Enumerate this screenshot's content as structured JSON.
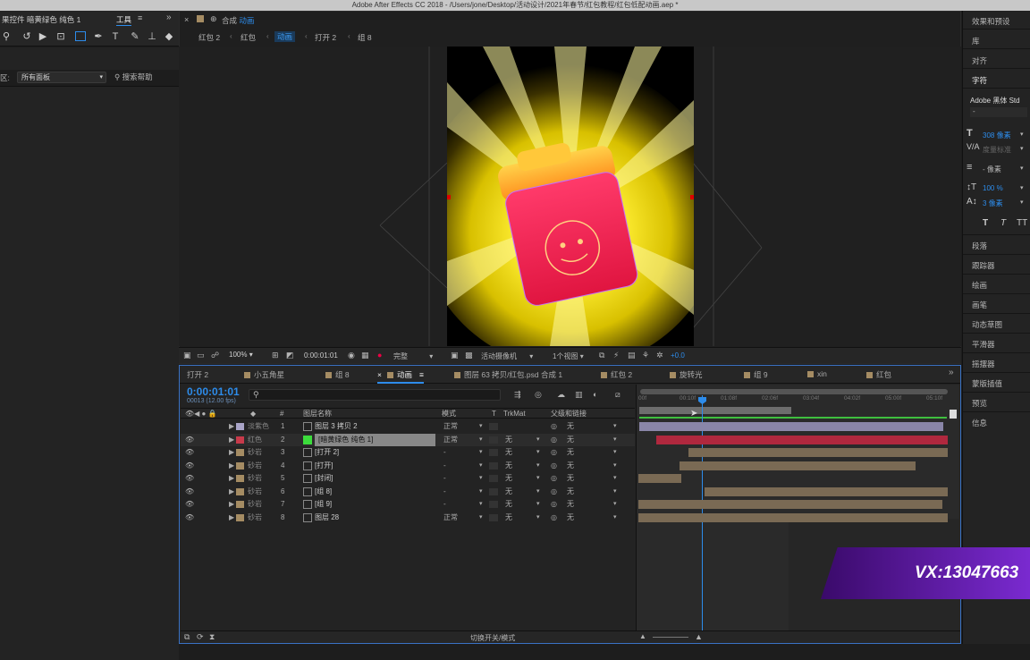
{
  "titlebar": "Adobe After Effects CC 2018 - /Users/jone/Desktop/活动设计/2021年春节/红包教程/红包低配动画.aep *",
  "left": {
    "effects_title": "果控件 暗黄绿色 纯色 1",
    "tools_title": "工具",
    "area_label": "区:",
    "panel_select": "所有面板",
    "search_help": "搜索帮助"
  },
  "comp": {
    "header_label": "合成",
    "header_name": "动画",
    "breadcrumbs": [
      "红包 2",
      "红包",
      "动画",
      "打开 2",
      "组 8"
    ],
    "active_crumb": "动画"
  },
  "viewer_bar": {
    "zoom": "100%",
    "timecode": "0:00:01:01",
    "quality": "完整",
    "camera": "活动摄像机",
    "views": "1个视图",
    "exposure": "+0.0"
  },
  "timeline": {
    "tabs": [
      "打开 2",
      "小五角星",
      "组 8",
      "动画",
      "图层 63 拷贝/红包.psd 合成 1",
      "红包 2",
      "旋转光",
      "组 9",
      "xin",
      "红包"
    ],
    "active_tab": "动画",
    "timecode": "0:00:01:01",
    "fps_info": "00013 (12.00 fps)",
    "col_headers": {
      "num": "#",
      "name": "图层名称",
      "mode": "模式",
      "t": "T",
      "trkmat": "TrkMat",
      "parent": "父级和链接"
    },
    "ruler": [
      "00f",
      "00:10f",
      "01:08f",
      "02:06f",
      "03:04f",
      "04:02f",
      "05:00f",
      "05:10f"
    ],
    "layers": [
      {
        "label": "淡紫色",
        "num": "1",
        "name": "图层 3 拷贝 2",
        "mode": "正常",
        "trkmat": "",
        "parent": "无",
        "color": "#a9a4c7"
      },
      {
        "label": "红色",
        "num": "2",
        "name": "[暗黄绿色 纯色 1]",
        "mode": "正常",
        "trkmat": "无",
        "parent": "无",
        "color": "#c83a4a"
      },
      {
        "label": "砂岩",
        "num": "3",
        "name": "[打开 2]",
        "mode": "-",
        "trkmat": "无",
        "parent": "无",
        "color": "#a58c63"
      },
      {
        "label": "砂岩",
        "num": "4",
        "name": "[打开]",
        "mode": "-",
        "trkmat": "无",
        "parent": "无",
        "color": "#a58c63"
      },
      {
        "label": "砂岩",
        "num": "5",
        "name": "[封闭]",
        "mode": "-",
        "trkmat": "无",
        "parent": "无",
        "color": "#a58c63"
      },
      {
        "label": "砂岩",
        "num": "6",
        "name": "[组 8]",
        "mode": "-",
        "trkmat": "无",
        "parent": "无",
        "color": "#a58c63"
      },
      {
        "label": "砂岩",
        "num": "7",
        "name": "[组 9]",
        "mode": "-",
        "trkmat": "无",
        "parent": "无",
        "color": "#a58c63"
      },
      {
        "label": "砂岩",
        "num": "8",
        "name": "图层 28",
        "mode": "正常",
        "trkmat": "无",
        "parent": "无",
        "color": "#a58c63"
      }
    ],
    "footer": "切换开关/模式"
  },
  "right": {
    "items_top": [
      "效果和预设",
      "库",
      "对齐",
      "字符"
    ],
    "font": "Adobe 黑体 Std",
    "font_style": "-",
    "size": "308 像素",
    "tracking_label": "度量标准",
    "leading": "- 像素",
    "scale": "100 %",
    "baseline": "3 像素",
    "items_bottom": [
      "段落",
      "跟踪器",
      "绘画",
      "画笔",
      "动态草图",
      "平滑器",
      "摇摆器",
      "蒙版插值",
      "预览",
      "信息"
    ]
  },
  "watermark": "VX:13047663"
}
